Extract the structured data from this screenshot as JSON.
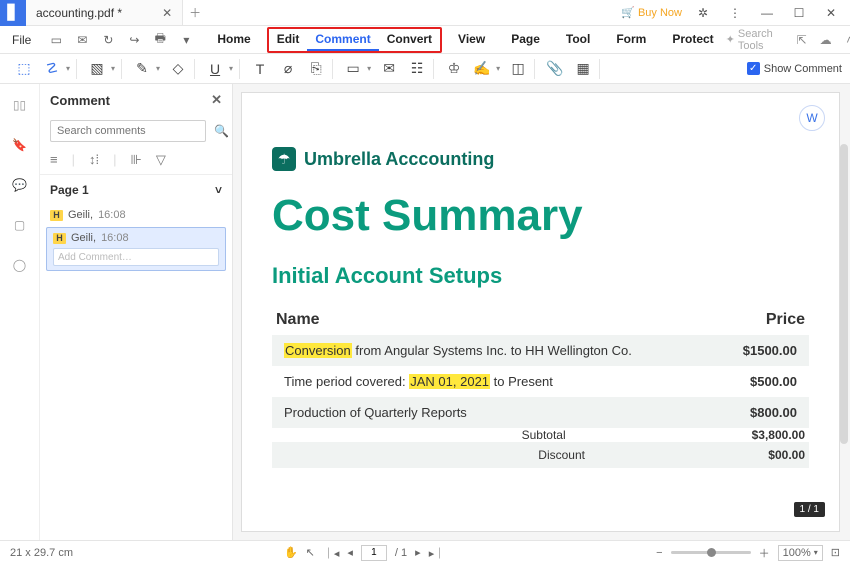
{
  "title_bar": {
    "file_name": "accounting.pdf *",
    "buy_now": "Buy Now"
  },
  "menu": {
    "file": "File",
    "tabs": [
      "Home",
      "Edit",
      "Comment",
      "Convert",
      "View",
      "Page",
      "Tool",
      "Form",
      "Protect"
    ],
    "search_placeholder": "Search Tools"
  },
  "toolbar": {
    "show_comment": "Show Comment"
  },
  "comment_panel": {
    "title": "Comment",
    "search_placeholder": "Search comments",
    "page_label": "Page 1",
    "items": [
      {
        "author": "Geili,",
        "time": "16:08"
      },
      {
        "author": "Geili,",
        "time": "16:08"
      }
    ],
    "add_placeholder": "Add Comment…"
  },
  "document": {
    "brand": "Umbrella Acccounting",
    "title": "Cost Summary",
    "section": "Initial Account Setups",
    "head_name": "Name",
    "head_price": "Price",
    "rows": [
      {
        "hl": "Conversion",
        "rest": " from Angular Systems Inc. to HH Wellington Co.",
        "price": "$1500.00"
      },
      {
        "prefix": "Time period covered: ",
        "hl": "JAN 01, 2021",
        "rest": " to Present",
        "price": "$500.00"
      },
      {
        "rest": "Production of Quarterly Reports",
        "price": "$800.00"
      }
    ],
    "subtotal_label": "Subtotal",
    "subtotal_value": "$3,800.00",
    "discount_label": "Discount",
    "discount_value": "$00.00",
    "page_badge": "1 / 1"
  },
  "status": {
    "dimensions": "21 x 29.7 cm",
    "page_current": "1",
    "page_total": "/ 1",
    "zoom": "100%"
  }
}
